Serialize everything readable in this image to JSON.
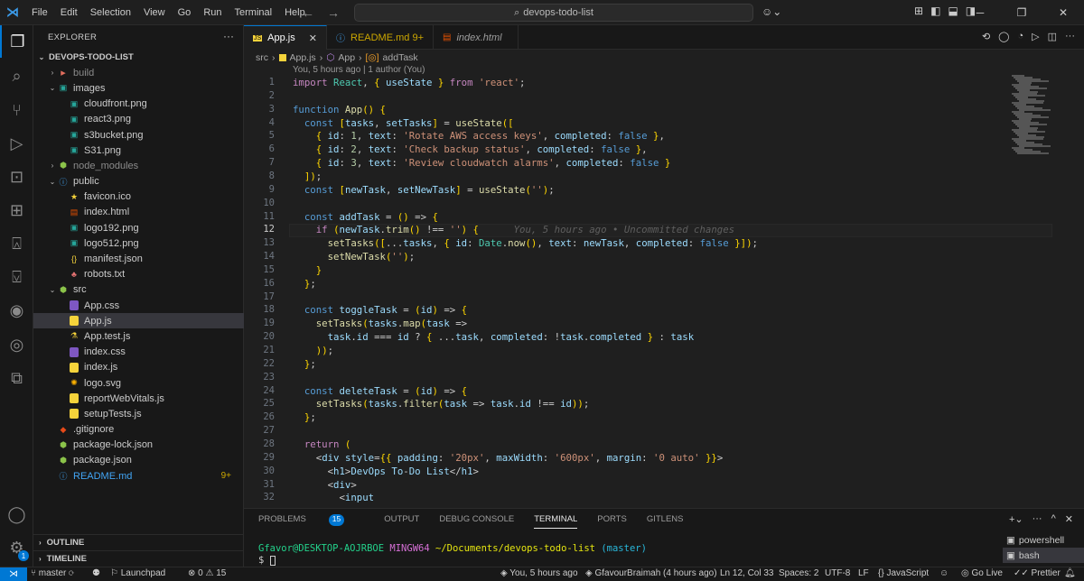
{
  "titlebar": {
    "menu": [
      "File",
      "Edit",
      "Selection",
      "View",
      "Go",
      "Run",
      "Terminal",
      "Help"
    ],
    "search": "devops-todo-list"
  },
  "explorer": {
    "header": "EXPLORER",
    "project": "DEVOPS-TODO-LIST",
    "items": [
      {
        "label": "build",
        "indent": 1,
        "type": "folder-closed",
        "icon": "folder",
        "dim": true
      },
      {
        "label": "images",
        "indent": 1,
        "type": "folder-open",
        "icon": "img"
      },
      {
        "label": "cloudfront.png",
        "indent": 2,
        "icon": "img"
      },
      {
        "label": "react3.png",
        "indent": 2,
        "icon": "img"
      },
      {
        "label": "s3bucket.png",
        "indent": 2,
        "icon": "img"
      },
      {
        "label": "S31.png",
        "indent": 2,
        "icon": "img"
      },
      {
        "label": "node_modules",
        "indent": 1,
        "type": "folder-closed",
        "icon": "node",
        "dim": true
      },
      {
        "label": "public",
        "indent": 1,
        "type": "folder-open",
        "icon": "info"
      },
      {
        "label": "favicon.ico",
        "indent": 2,
        "icon": "star"
      },
      {
        "label": "index.html",
        "indent": 2,
        "icon": "html"
      },
      {
        "label": "logo192.png",
        "indent": 2,
        "icon": "img"
      },
      {
        "label": "logo512.png",
        "indent": 2,
        "icon": "img"
      },
      {
        "label": "manifest.json",
        "indent": 2,
        "icon": "json"
      },
      {
        "label": "robots.txt",
        "indent": 2,
        "icon": "robot"
      },
      {
        "label": "src",
        "indent": 1,
        "type": "folder-open",
        "icon": "node"
      },
      {
        "label": "App.css",
        "indent": 2,
        "icon": "css"
      },
      {
        "label": "App.js",
        "indent": 2,
        "icon": "js",
        "selected": true
      },
      {
        "label": "App.test.js",
        "indent": 2,
        "icon": "test"
      },
      {
        "label": "index.css",
        "indent": 2,
        "icon": "css"
      },
      {
        "label": "index.js",
        "indent": 2,
        "icon": "js"
      },
      {
        "label": "logo.svg",
        "indent": 2,
        "icon": "svg"
      },
      {
        "label": "reportWebVitals.js",
        "indent": 2,
        "icon": "js"
      },
      {
        "label": "setupTests.js",
        "indent": 2,
        "icon": "js"
      },
      {
        "label": ".gitignore",
        "indent": 1,
        "icon": "git"
      },
      {
        "label": "package-lock.json",
        "indent": 1,
        "icon": "node"
      },
      {
        "label": "package.json",
        "indent": 1,
        "icon": "node"
      },
      {
        "label": "README.md",
        "indent": 1,
        "icon": "info",
        "badge": "9+"
      }
    ],
    "outline": "OUTLINE",
    "timeline": "TIMELINE"
  },
  "tabs": [
    {
      "label": "App.js",
      "icon": "JS"
    },
    {
      "label": "README.md 9+",
      "icon": "i"
    },
    {
      "label": "index.html",
      "icon": "5"
    }
  ],
  "breadcrumb": {
    "parts": [
      "src",
      "App.js",
      "App",
      "addTask"
    ]
  },
  "blame": "You, 5 hours ago | 1 author (You)",
  "inline_blame": "You, 5 hours ago • Uncommitted changes",
  "current_line": 12,
  "code_lines": [
    "import React, { useState } from 'react';",
    "",
    "function App() {",
    "  const [tasks, setTasks] = useState([",
    "    { id: 1, text: 'Rotate AWS access keys', completed: false },",
    "    { id: 2, text: 'Check backup status', completed: false },",
    "    { id: 3, text: 'Review cloudwatch alarms', completed: false }",
    "  ]);",
    "  const [newTask, setNewTask] = useState('');",
    "",
    "  const addTask = () => {",
    "    if (newTask.trim() !== '') {",
    "      setTasks([...tasks, { id: Date.now(), text: newTask, completed: false }]);",
    "      setNewTask('');",
    "    }",
    "  };",
    "",
    "  const toggleTask = (id) => {",
    "    setTasks(tasks.map(task =>",
    "      task.id === id ? { ...task, completed: !task.completed } : task",
    "    ));",
    "  };",
    "",
    "  const deleteTask = (id) => {",
    "    setTasks(tasks.filter(task => task.id !== id));",
    "  };",
    "",
    "  return (",
    "    <div style={{ padding: '20px', maxWidth: '600px', margin: '0 auto' }}>",
    "      <h1>DevOps To-Do List</h1>",
    "      <div>",
    "        <input"
  ],
  "panel": {
    "tabs": [
      "PROBLEMS",
      "OUTPUT",
      "DEBUG CONSOLE",
      "TERMINAL",
      "PORTS",
      "GITLENS"
    ],
    "problems_count": "15",
    "active_tab": "TERMINAL",
    "prompt_user": "Gfavor@DESKTOP-AOJRBOE",
    "prompt_env": "MINGW64",
    "prompt_path": "~/Documents/devops-todo-list",
    "prompt_branch": "(master)",
    "prompt_symbol": "$",
    "shells": [
      "powershell",
      "bash"
    ]
  },
  "statusbar": {
    "branch": "master",
    "launchpad": "Launchpad",
    "problems": "⊗ 0 ⚠ 15",
    "blame": "You, 5 hours ago",
    "author": "GfavourBraimah (4 hours ago)",
    "position": "Ln 12, Col 33",
    "spaces": "Spaces: 2",
    "encoding": "UTF-8",
    "eol": "LF",
    "language": "JavaScript",
    "golive": "Go Live",
    "prettier": "Prettier"
  },
  "colors": {
    "accent": "#0078d4",
    "bg": "#1f1f1f",
    "sidebar": "#181818"
  }
}
